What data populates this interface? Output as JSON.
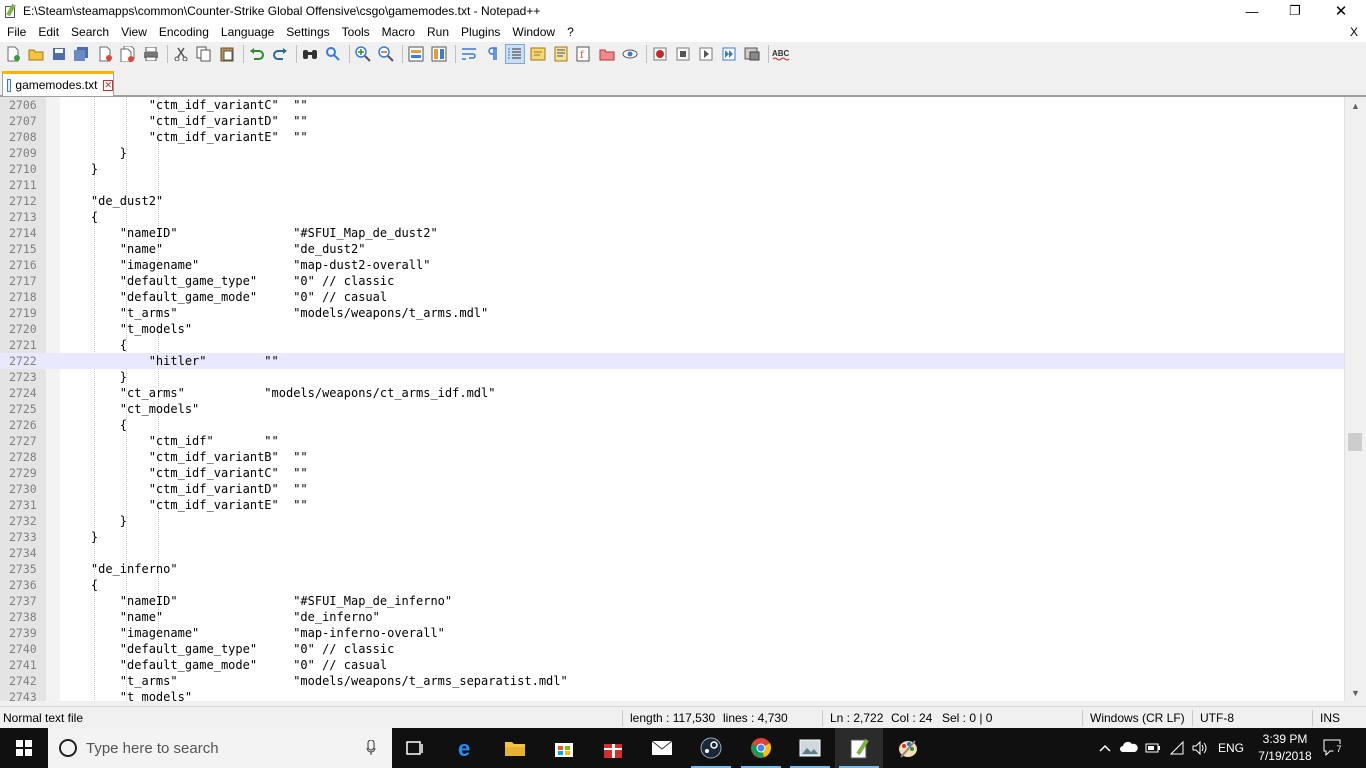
{
  "window": {
    "title": "E:\\Steam\\steamapps\\common\\Counter-Strike Global Offensive\\csgo\\gamemodes.txt - Notepad++",
    "minimize_glyph": "—",
    "maximize_glyph": "❐",
    "close_glyph": "✕"
  },
  "menu": {
    "items": [
      "File",
      "Edit",
      "Search",
      "View",
      "Encoding",
      "Language",
      "Settings",
      "Tools",
      "Macro",
      "Run",
      "Plugins",
      "Window",
      "?"
    ],
    "close_label": "X"
  },
  "tabs": [
    {
      "label": "gamemodes.txt",
      "active": true
    }
  ],
  "editor": {
    "current_line": 2722,
    "lines": [
      {
        "n": "2706",
        "text": "            \"ctm_idf_variantC\"  \"\""
      },
      {
        "n": "2707",
        "text": "            \"ctm_idf_variantD\"  \"\""
      },
      {
        "n": "2708",
        "text": "            \"ctm_idf_variantE\"  \"\""
      },
      {
        "n": "2709",
        "text": "        }"
      },
      {
        "n": "2710",
        "text": "    }"
      },
      {
        "n": "2711",
        "text": ""
      },
      {
        "n": "2712",
        "text": "    \"de_dust2\""
      },
      {
        "n": "2713",
        "text": "    {"
      },
      {
        "n": "2714",
        "text": "        \"nameID\"                \"#SFUI_Map_de_dust2\""
      },
      {
        "n": "2715",
        "text": "        \"name\"                  \"de_dust2\""
      },
      {
        "n": "2716",
        "text": "        \"imagename\"             \"map-dust2-overall\""
      },
      {
        "n": "2717",
        "text": "        \"default_game_type\"     \"0\" // classic"
      },
      {
        "n": "2718",
        "text": "        \"default_game_mode\"     \"0\" // casual"
      },
      {
        "n": "2719",
        "text": "        \"t_arms\"                \"models/weapons/t_arms.mdl\""
      },
      {
        "n": "2720",
        "text": "        \"t_models\""
      },
      {
        "n": "2721",
        "text": "        {"
      },
      {
        "n": "2722",
        "text": "            \"hitler\"        \"\""
      },
      {
        "n": "2723",
        "text": "        }"
      },
      {
        "n": "2724",
        "text": "        \"ct_arms\"           \"models/weapons/ct_arms_idf.mdl\""
      },
      {
        "n": "2725",
        "text": "        \"ct_models\""
      },
      {
        "n": "2726",
        "text": "        {"
      },
      {
        "n": "2727",
        "text": "            \"ctm_idf\"       \"\""
      },
      {
        "n": "2728",
        "text": "            \"ctm_idf_variantB\"  \"\""
      },
      {
        "n": "2729",
        "text": "            \"ctm_idf_variantC\"  \"\""
      },
      {
        "n": "2730",
        "text": "            \"ctm_idf_variantD\"  \"\""
      },
      {
        "n": "2731",
        "text": "            \"ctm_idf_variantE\"  \"\""
      },
      {
        "n": "2732",
        "text": "        }"
      },
      {
        "n": "2733",
        "text": "    }"
      },
      {
        "n": "2734",
        "text": ""
      },
      {
        "n": "2735",
        "text": "    \"de_inferno\""
      },
      {
        "n": "2736",
        "text": "    {"
      },
      {
        "n": "2737",
        "text": "        \"nameID\"                \"#SFUI_Map_de_inferno\""
      },
      {
        "n": "2738",
        "text": "        \"name\"                  \"de_inferno\""
      },
      {
        "n": "2739",
        "text": "        \"imagename\"             \"map-inferno-overall\""
      },
      {
        "n": "2740",
        "text": "        \"default_game_type\"     \"0\" // classic"
      },
      {
        "n": "2741",
        "text": "        \"default_game_mode\"     \"0\" // casual"
      },
      {
        "n": "2742",
        "text": "        \"t_arms\"                \"models/weapons/t_arms_separatist.mdl\""
      },
      {
        "n": "2743",
        "text": "        \"t_models\""
      }
    ]
  },
  "status": {
    "file_type": "Normal text file",
    "length": "length : 117,530",
    "lines": "lines : 4,730",
    "ln": "Ln : 2,722",
    "col": "Col : 24",
    "sel": "Sel : 0 | 0",
    "eol": "Windows (CR LF)",
    "encoding": "UTF-8",
    "mode": "INS"
  },
  "taskbar": {
    "search_placeholder": "Type here to search",
    "language": "ENG",
    "time": "3:39 PM",
    "date": "7/19/2018",
    "notification_count": "7"
  },
  "colors": {
    "current_line": "#e8e8ff",
    "gutter": "#e4e4e4",
    "tab_accent": "#fab400",
    "taskbar": "#101010"
  }
}
